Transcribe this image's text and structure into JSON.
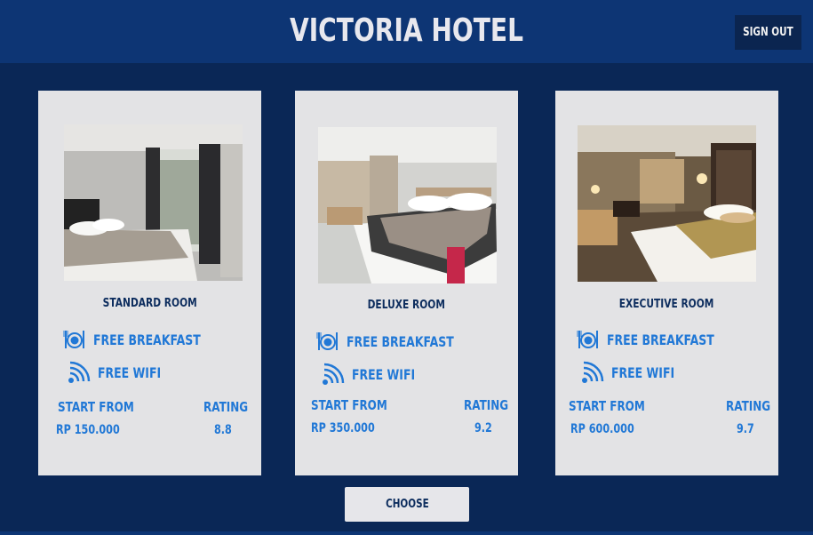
{
  "header": {
    "title": "VICTORIA HOTEL",
    "signout_label": "SIGN OUT"
  },
  "rooms": [
    {
      "name": "STANDARD ROOM",
      "features": [
        "FREE BREAKFAST",
        "FREE WIFI"
      ],
      "price_label": "START FROM",
      "price": "RP 150.000",
      "rating_label": "RATING",
      "rating": "8.8"
    },
    {
      "name": "DELUXE ROOM",
      "features": [
        "FREE BREAKFAST",
        "FREE WIFI"
      ],
      "price_label": "START FROM",
      "price": "RP 350.000",
      "rating_label": "RATING",
      "rating": "9.2"
    },
    {
      "name": "EXECUTIVE ROOM",
      "features": [
        "FREE BREAKFAST",
        "FREE WIFI"
      ],
      "price_label": "START FROM",
      "price": "RP 600.000",
      "rating_label": "RATING",
      "rating": "9.7"
    }
  ],
  "icons": {
    "breakfast": "dining-plate-icon",
    "wifi": "wifi-signal-icon"
  },
  "colors": {
    "background": "#0a2756",
    "header": "#0d3574",
    "card": "#e3e3e5",
    "accent": "#2178d6",
    "dark_text": "#0d2d5e"
  },
  "footer": {
    "choose_label": "CHOOSE"
  }
}
